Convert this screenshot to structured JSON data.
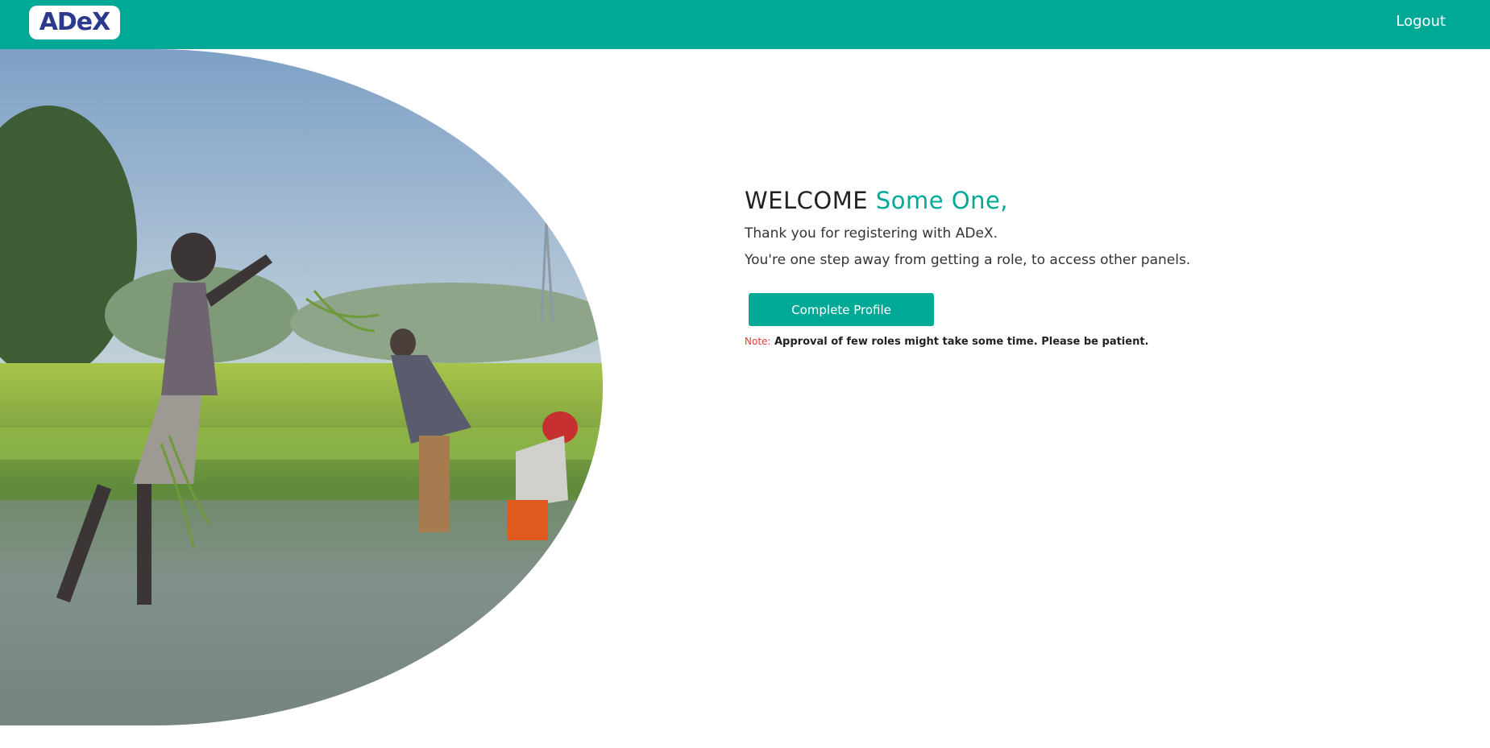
{
  "header": {
    "logo_text": "ADeX",
    "logout_label": "Logout"
  },
  "welcome": {
    "greeting": "WELCOME",
    "name": "Some One,",
    "line1": "Thank you for registering with ADeX.",
    "line2": "You're one step away from getting a role, to access other panels.",
    "button_label": "Complete Profile",
    "note_label": "Note:",
    "note_text": "Approval of few roles might take some time. Please be patient."
  },
  "colors": {
    "primary": "#00a896",
    "logo": "#2b3a8c",
    "note_label": "#e53935"
  }
}
